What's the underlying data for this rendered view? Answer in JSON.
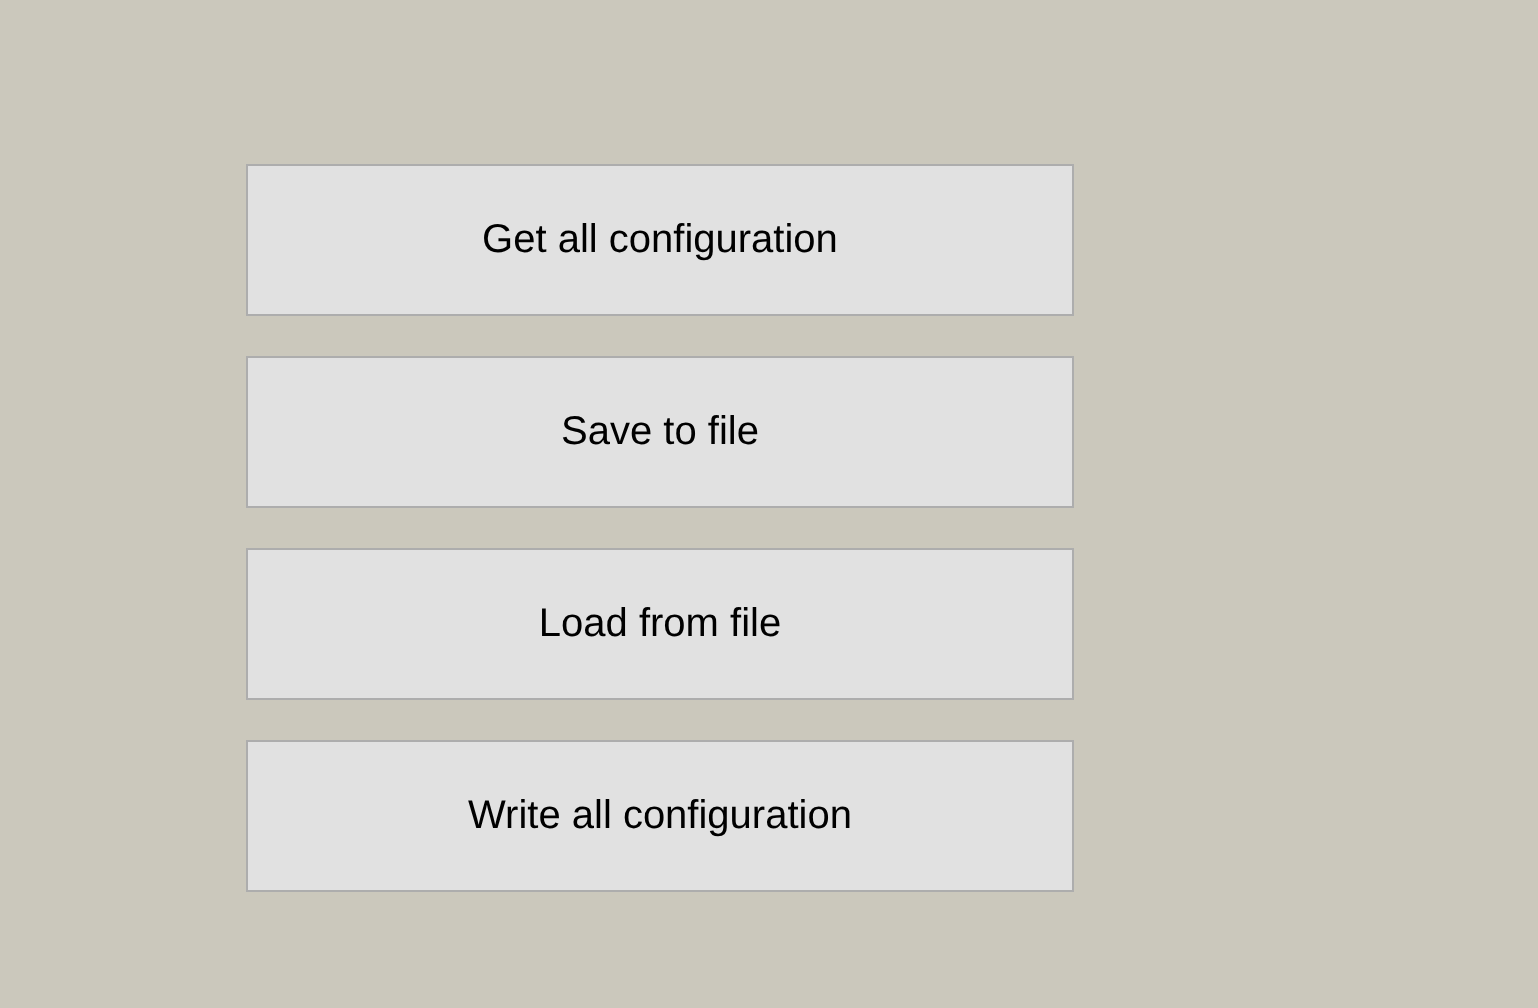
{
  "buttons": [
    {
      "label": "Get all configuration"
    },
    {
      "label": "Save to file"
    },
    {
      "label": "Load from file"
    },
    {
      "label": "Write all configuration"
    }
  ]
}
